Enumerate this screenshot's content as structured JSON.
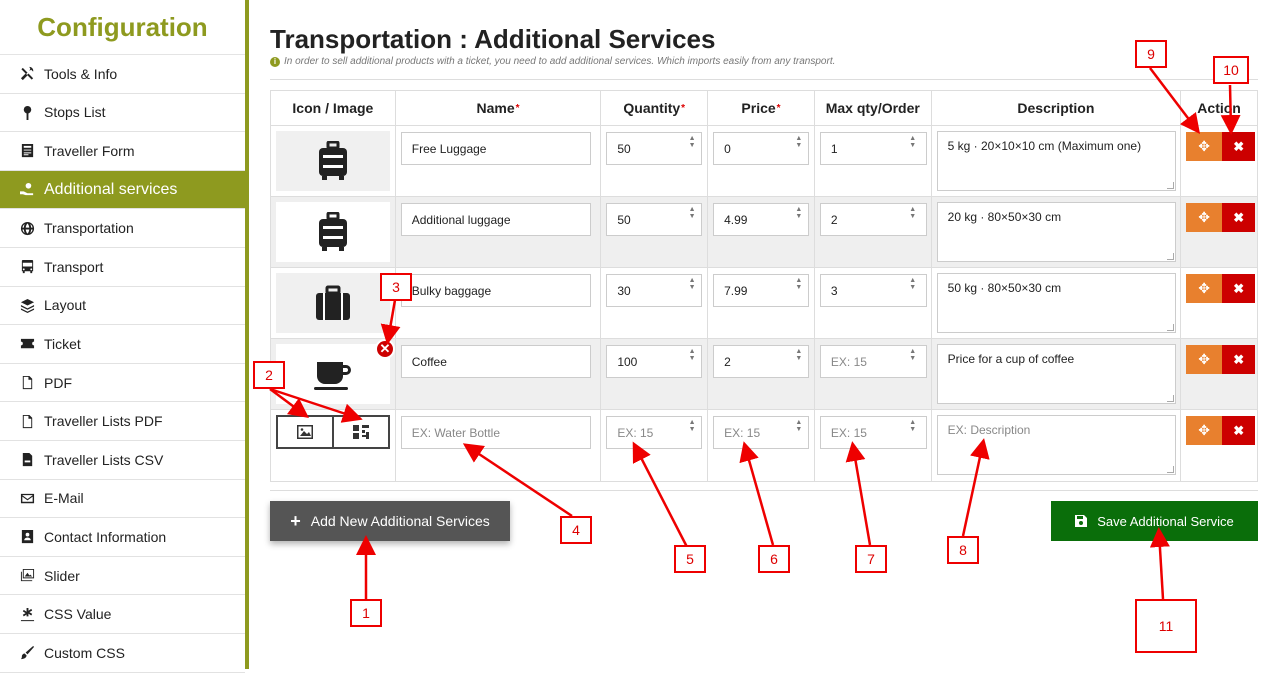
{
  "sidebar": {
    "title": "Configuration",
    "items": [
      {
        "label": "Tools & Info",
        "icon": "wrench-icon"
      },
      {
        "label": "Stops List",
        "icon": "pin-icon"
      },
      {
        "label": "Traveller Form",
        "icon": "form-icon"
      },
      {
        "label": "Additional services",
        "icon": "hand-coin-icon",
        "active": true
      },
      {
        "label": "Transportation",
        "icon": "globe-icon"
      },
      {
        "label": "Transport",
        "icon": "bus-icon"
      },
      {
        "label": "Layout",
        "icon": "layers-icon"
      },
      {
        "label": "Ticket",
        "icon": "ticket-icon"
      },
      {
        "label": "PDF",
        "icon": "pdf-icon"
      },
      {
        "label": "Traveller Lists PDF",
        "icon": "pdf-icon"
      },
      {
        "label": "Traveller Lists CSV",
        "icon": "csv-icon"
      },
      {
        "label": "E-Mail",
        "icon": "envelope-icon"
      },
      {
        "label": "Contact Information",
        "icon": "contact-icon"
      },
      {
        "label": "Slider",
        "icon": "images-icon"
      },
      {
        "label": "CSS Value",
        "icon": "css-icon"
      },
      {
        "label": "Custom CSS",
        "icon": "brush-icon"
      }
    ]
  },
  "main": {
    "title": "Transportation : Additional Services",
    "note": "In order to sell additional products with a ticket, you need to add additional services. Which imports easily from any transport.",
    "headers": {
      "icon": "Icon / Image",
      "name": "Name",
      "quantity": "Quantity",
      "price": "Price",
      "max": "Max qty/Order",
      "description": "Description",
      "action": "Action"
    },
    "rows": [
      {
        "icon": "luggage-icon",
        "name": "Free Luggage",
        "quantity": "50",
        "price": "0",
        "max": "1",
        "description": "5 kg · 20×10×10 cm (Maximum one)"
      },
      {
        "icon": "luggage-icon",
        "name": "Additional luggage",
        "quantity": "50",
        "price": "4.99",
        "max": "2",
        "description": "20 kg · 80×50×30 cm"
      },
      {
        "icon": "suitcase-icon",
        "name": "Bulky baggage",
        "quantity": "30",
        "price": "7.99",
        "max": "3",
        "description": "50 kg · 80×50×30 cm"
      },
      {
        "icon": "coffee-cup-icon",
        "name": "Coffee",
        "quantity": "100",
        "price": "2",
        "max_placeholder": "EX: 15",
        "description": "Price for a cup of coffee"
      }
    ],
    "new_row": {
      "name_placeholder": "EX: Water Bottle",
      "quantity_placeholder": "EX: 15",
      "price_placeholder": "EX: 15",
      "max_placeholder": "EX: 15",
      "description_placeholder": "EX: Description"
    },
    "add_button": "Add New Additional Services",
    "save_button": "Save Additional Service"
  },
  "annotations": [
    "1",
    "2",
    "3",
    "4",
    "5",
    "6",
    "7",
    "8",
    "9",
    "10",
    "11"
  ],
  "colors": {
    "accent": "#8e9a1f",
    "move": "#e8802e",
    "delete": "#cc0000",
    "save": "#0a6e0a",
    "add": "#555555",
    "annotation": "#e00000"
  }
}
